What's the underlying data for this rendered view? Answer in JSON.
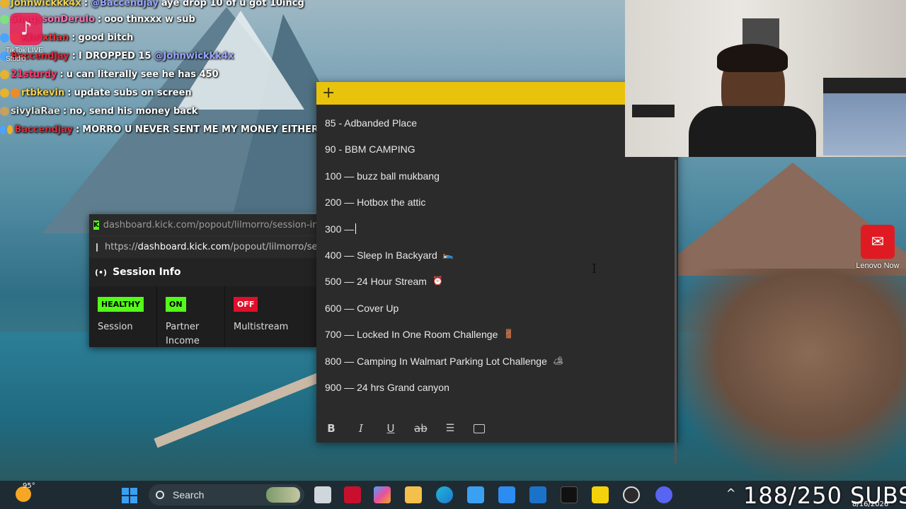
{
  "chat": {
    "lines": [
      {
        "user": "Johnwickkk4x",
        "user_color": "#f0d34a",
        "mention": "@Baccendjay",
        "msg": "aye drop 10 of u got 10incg"
      },
      {
        "user": "ShaqssonDerulo",
        "user_color": "#ff6fb0",
        "mention": "",
        "msg": "ooo thnxxx w sub"
      },
      {
        "user": "Khrixtian",
        "user_color": "#e33",
        "mention": "",
        "msg": "good bitch"
      },
      {
        "user": "Baccendjay",
        "user_color": "#e02a3a",
        "mention": "@Johnwickkk4x",
        "msg": "I DROPPED 15"
      },
      {
        "user": "21sturdy",
        "user_color": "#ff3a6a",
        "mention": "",
        "msg": "u can literally see he has 450"
      },
      {
        "user": "rtbkevin",
        "user_color": "#f5d24a",
        "mention": "",
        "msg": "update subs on screen"
      },
      {
        "user": "sivylaRae",
        "user_color": "#e6e6e6",
        "mention": "",
        "msg": "no, send his money back"
      },
      {
        "user": "Baccendjay",
        "user_color": "#e02a3a",
        "mention": "",
        "msg": "MORRO U NEVER SENT ME MY MONEY EITHER"
      }
    ],
    "separator": ":"
  },
  "tiktok": {
    "label_line1": "TikTok LIVE",
    "label_line2": "Studio"
  },
  "kick": {
    "title_url": "dashboard.kick.com/popout/lilmorro/session-in",
    "address_scheme": "https://",
    "address_host": "dashboard.kick.com",
    "address_path": "/popout/lilmorro/se",
    "header": "Session Info",
    "cards": [
      {
        "pill": "HEALTHY",
        "label": "Session",
        "color": "green"
      },
      {
        "pill": "ON",
        "label": "Partner Income",
        "color": "green"
      },
      {
        "pill": "OFF",
        "label": "Multistream",
        "color": "red"
      }
    ]
  },
  "sticky": {
    "add_label": "+",
    "lines": [
      {
        "text": "85 -  Adbanded Place",
        "emoji": ""
      },
      {
        "text": "90 - BBM CAMPING",
        "emoji": ""
      },
      {
        "text": "100 — buzz ball mukbang",
        "emoji": ""
      },
      {
        "text": "200 — Hotbox the attic",
        "emoji": ""
      },
      {
        "text": "300 —",
        "emoji": ""
      },
      {
        "text": "400 — Sleep In Backyard",
        "emoji": "🛌"
      },
      {
        "text": "500 — 24 Hour Stream",
        "emoji": "⏰"
      },
      {
        "text": "600 — Cover Up",
        "emoji": ""
      },
      {
        "text": "700 — Locked In One Room Challenge",
        "emoji": "🚪"
      },
      {
        "text": "800 — Camping In Walmart Parking Lot Challenge",
        "emoji": "🏕"
      },
      {
        "text": "900 — 24 hrs Grand canyon",
        "emoji": ""
      }
    ],
    "toolbar": {
      "bold": "B",
      "italic": "I",
      "underline": "U",
      "strike": "ab",
      "list": "☰"
    }
  },
  "lenovo": {
    "label": "Lenovo Now"
  },
  "taskbar": {
    "weather_temp": "95°",
    "search_label": "Search",
    "subs_text": "188/250 SUBS",
    "date": "8/16/2026"
  }
}
